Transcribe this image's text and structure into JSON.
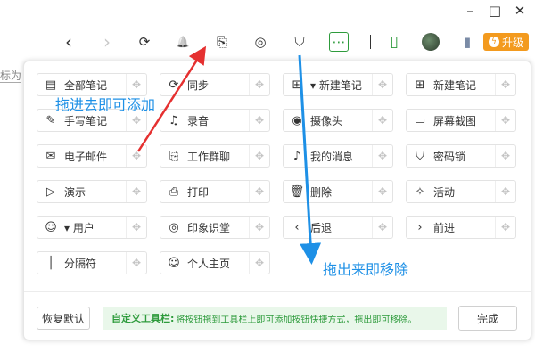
{
  "window": {
    "minimize_icon": "minimize-icon",
    "maximize_icon": "maximize-icon",
    "close_icon": "close-icon",
    "min_glyph": "–",
    "max_glyph": "□",
    "close_glyph": "✕"
  },
  "toolbar": {
    "back_glyph": "‹",
    "forward_glyph": "›",
    "sync_glyph": "⟳",
    "bell_glyph": "🔔",
    "share_glyph": "⎘",
    "at_glyph": "◎",
    "shield_glyph": "⛉",
    "more_glyph": "⋯",
    "phone_glyph": "▯",
    "book_glyph": "▮",
    "upgrade_label": "升级",
    "upgrade_bolt": "ϟ",
    "accent": "#f39a1e",
    "more_border": "#2e9b3c"
  },
  "left_edge_text": "标为",
  "items": [
    {
      "label": "全部笔记",
      "icon": "notes-icon",
      "glyph": "▤"
    },
    {
      "label": "同步",
      "icon": "sync-icon",
      "glyph": "⟳"
    },
    {
      "label": "▾ 新建笔记",
      "icon": "new-note-dropdown-icon",
      "glyph": "⊞"
    },
    {
      "label": "新建笔记",
      "icon": "new-note-icon",
      "glyph": "⊞"
    },
    {
      "label": "手写笔记",
      "icon": "pen-icon",
      "glyph": "✎"
    },
    {
      "label": "录音",
      "icon": "record-icon",
      "glyph": "♫"
    },
    {
      "label": "摄像头",
      "icon": "camera-icon",
      "glyph": "◉"
    },
    {
      "label": "屏幕截图",
      "icon": "screenshot-icon",
      "glyph": "▭"
    },
    {
      "label": "电子邮件",
      "icon": "email-icon",
      "glyph": "✉"
    },
    {
      "label": "工作群聊",
      "icon": "chat-icon",
      "glyph": "⎘"
    },
    {
      "label": "我的消息",
      "icon": "bell-icon",
      "glyph": "♪"
    },
    {
      "label": "密码锁",
      "icon": "lock-icon",
      "glyph": "⛉"
    },
    {
      "label": "演示",
      "icon": "present-icon",
      "glyph": "▷"
    },
    {
      "label": "打印",
      "icon": "print-icon",
      "glyph": "⎙"
    },
    {
      "label": "删除",
      "icon": "trash-icon",
      "glyph": "🗑"
    },
    {
      "label": "活动",
      "icon": "activity-icon",
      "glyph": "✧"
    },
    {
      "label": "▾ 用户",
      "icon": "user-icon",
      "glyph": "☺"
    },
    {
      "label": "印象识堂",
      "icon": "course-icon",
      "glyph": "◎"
    },
    {
      "label": "后退",
      "icon": "back-icon",
      "glyph": "‹"
    },
    {
      "label": "前进",
      "icon": "forward-icon",
      "glyph": "›"
    },
    {
      "label": "分隔符",
      "icon": "separator-icon",
      "glyph": "│"
    },
    {
      "label": "个人主页",
      "icon": "profile-icon",
      "glyph": "☺"
    }
  ],
  "drag_glyph": "✥",
  "annotations": {
    "add": "拖进去即可添加",
    "remove": "拖出来即移除",
    "color": "#1e90e6",
    "arrow_color": "#e53030"
  },
  "footer": {
    "reset_label": "恢复默认",
    "tip_title": "自定义工具栏:",
    "tip_text": "将按钮拖到工具栏上即可添加按钮快捷方式，拖出即可移除。",
    "done_label": "完成"
  }
}
